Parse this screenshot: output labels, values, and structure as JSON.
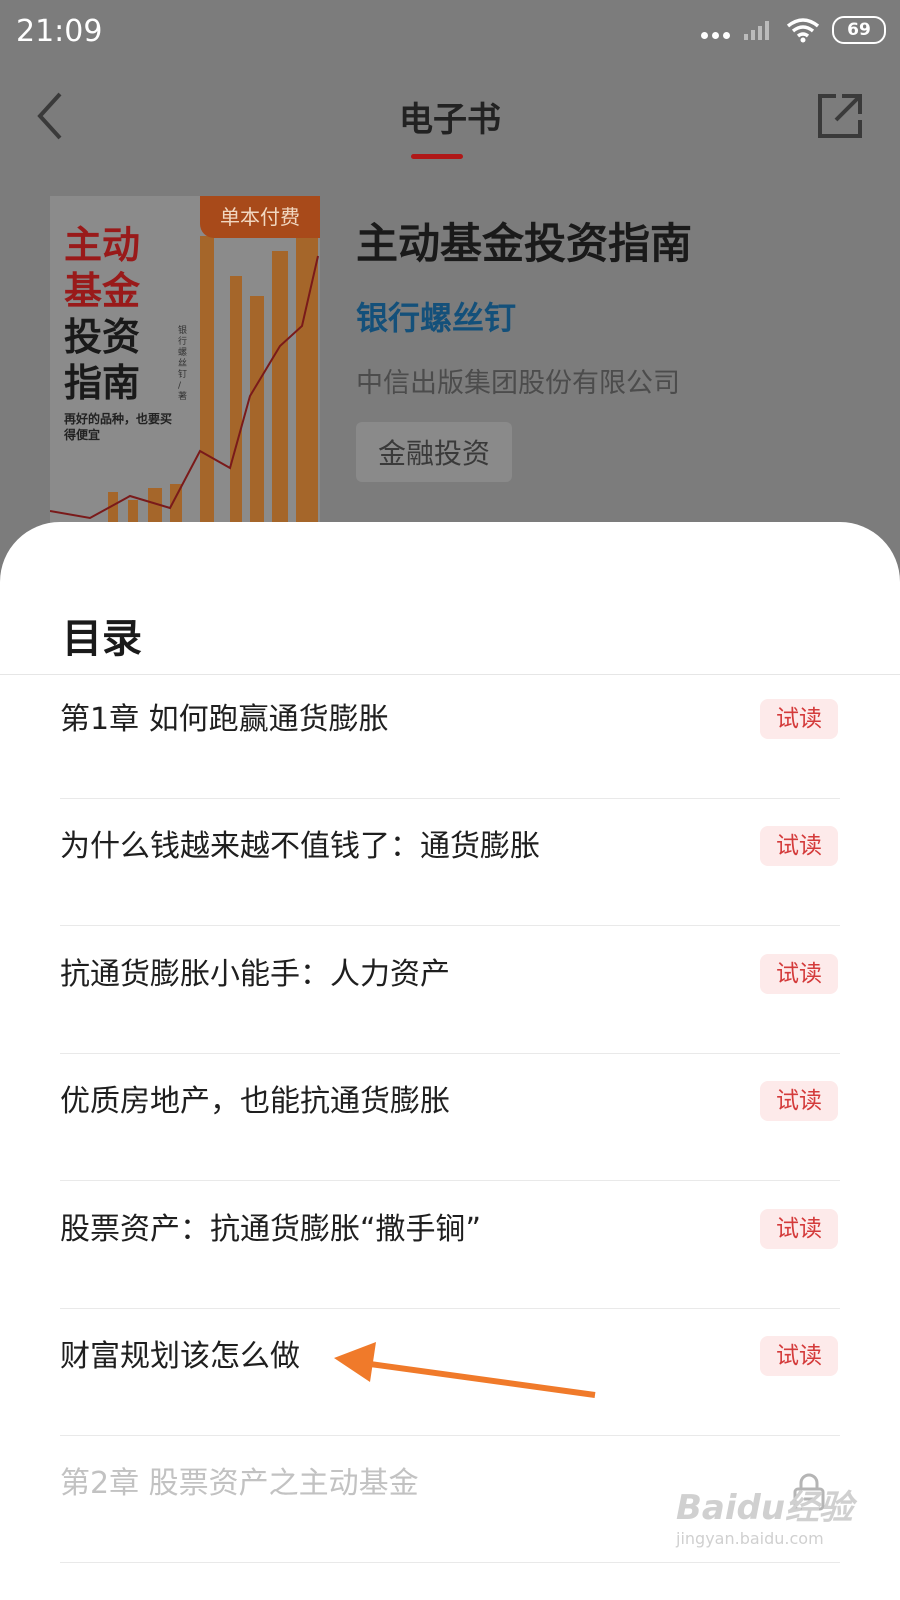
{
  "status_bar": {
    "time": "21:09",
    "battery": "69"
  },
  "nav": {
    "title": "电子书"
  },
  "book": {
    "cover": {
      "badge": "单本付费",
      "title_lines": [
        "主动",
        "基金",
        "投资",
        "指南"
      ],
      "slogan": "再好的品种，也要买得便宜",
      "author_vertical": "银行螺丝钉 / 著"
    },
    "title": "主动基金投资指南",
    "author": "银行螺丝钉",
    "publisher": "中信出版集团股份有限公司",
    "tag": "金融投资"
  },
  "toc": {
    "heading": "目录",
    "trial_label": "试读",
    "items": [
      {
        "label": "第1章 如何跑赢通货膨胀",
        "status": "trial"
      },
      {
        "label": "为什么钱越来越不值钱了：通货膨胀",
        "status": "trial"
      },
      {
        "label": "抗通货膨胀小能手：人力资产",
        "status": "trial"
      },
      {
        "label": "优质房地产，也能抗通货膨胀",
        "status": "trial"
      },
      {
        "label": "股票资产：抗通货膨胀“撒手锏”",
        "status": "trial"
      },
      {
        "label": "财富规划该怎么做",
        "status": "trial"
      },
      {
        "label": "第2章 股票资产之主动基金",
        "status": "locked"
      }
    ]
  },
  "watermark": {
    "main": "Baidu经验",
    "sub": "jingyan.baidu.com"
  },
  "colors": {
    "accent": "#b01818",
    "trial_text": "#d43b3b",
    "trial_bg": "#fdeaea",
    "author": "#14507a",
    "arrow": "#f07a2a"
  }
}
